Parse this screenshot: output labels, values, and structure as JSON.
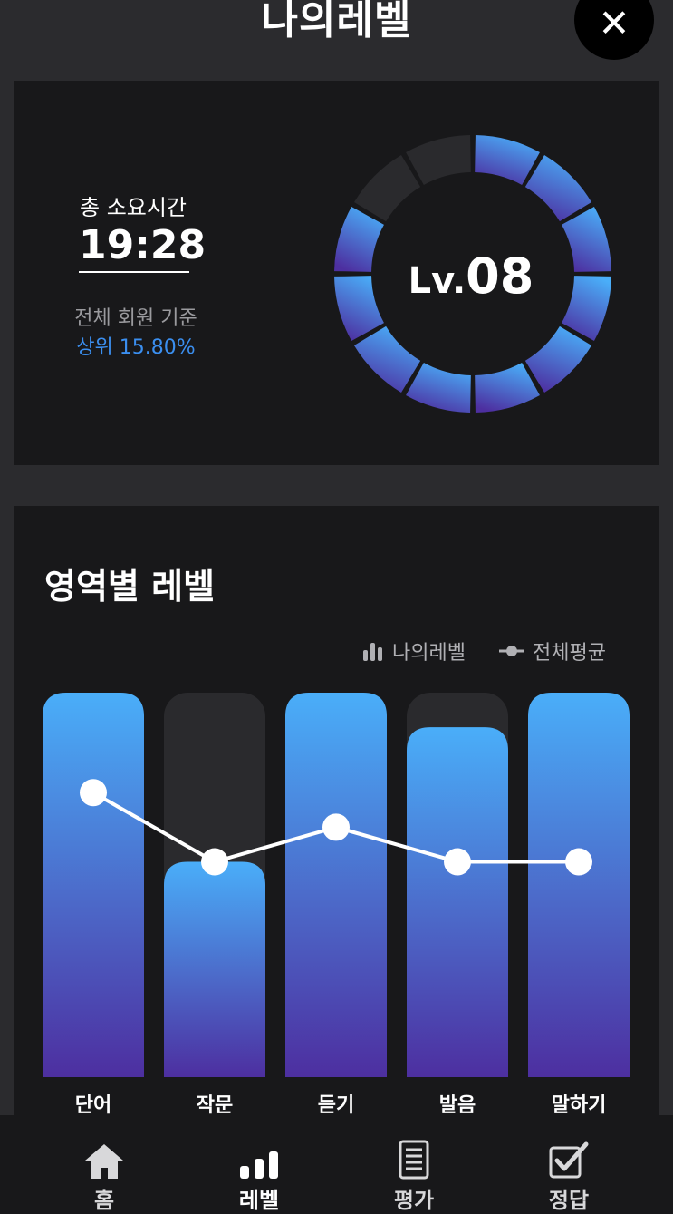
{
  "header": {
    "title": "나의레벨",
    "close_label": "✕"
  },
  "summary": {
    "time_label": "총 소요시간",
    "time_value": "19:28",
    "basis_label": "전체 회원 기준",
    "rank_label": "상위 15.80%",
    "level_prefix": "Lv.",
    "level_number": "08",
    "level_segments_total": 12,
    "level_segments_filled": 10
  },
  "area": {
    "title": "영역별 레벨",
    "legend": {
      "my_level": "나의레벨",
      "average": "전체평균"
    }
  },
  "chart_data": {
    "type": "bar",
    "categories": [
      "단어",
      "작문",
      "듣기",
      "발음",
      "말하기"
    ],
    "ylim": [
      0,
      100
    ],
    "series": [
      {
        "name": "나의레벨",
        "type": "bar",
        "values": [
          100,
          56,
          100,
          91,
          100
        ]
      },
      {
        "name": "전체평균",
        "type": "line",
        "values": [
          74,
          56,
          65,
          56,
          56
        ]
      }
    ],
    "legend_position": "top-right",
    "grid": false
  },
  "nav": {
    "items": [
      {
        "label": "홈",
        "icon": "home-icon"
      },
      {
        "label": "레벨",
        "icon": "bar-chart-icon"
      },
      {
        "label": "평가",
        "icon": "document-icon"
      },
      {
        "label": "정답",
        "icon": "checkbox-icon"
      }
    ],
    "active_index": 1
  },
  "colors": {
    "accent_blue": "#3b8ff0",
    "bar_top": "#4aaef9",
    "bar_bottom": "#4d2fa0",
    "track": "#2a2a2d",
    "background": "#2b2b2e",
    "card": "#18181a"
  }
}
